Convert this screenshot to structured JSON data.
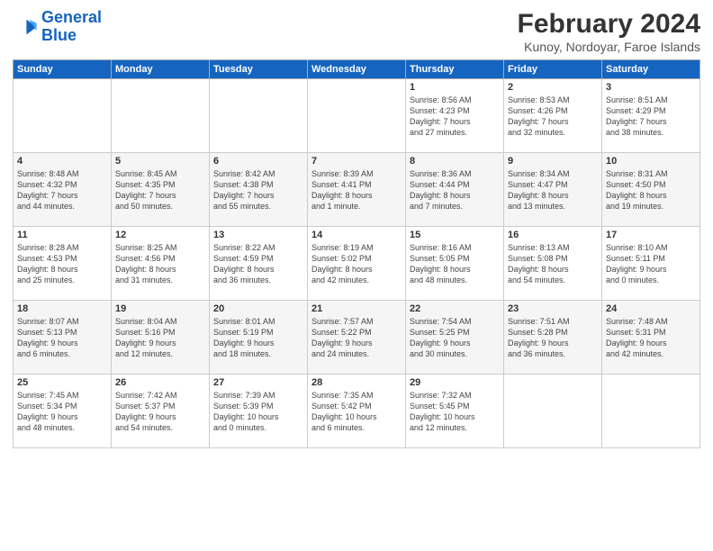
{
  "header": {
    "logo_line1": "General",
    "logo_line2": "Blue",
    "title": "February 2024",
    "subtitle": "Kunoy, Nordoyar, Faroe Islands"
  },
  "days_of_week": [
    "Sunday",
    "Monday",
    "Tuesday",
    "Wednesday",
    "Thursday",
    "Friday",
    "Saturday"
  ],
  "weeks": [
    [
      {
        "day": "",
        "content": ""
      },
      {
        "day": "",
        "content": ""
      },
      {
        "day": "",
        "content": ""
      },
      {
        "day": "",
        "content": ""
      },
      {
        "day": "1",
        "content": "Sunrise: 8:56 AM\nSunset: 4:23 PM\nDaylight: 7 hours\nand 27 minutes."
      },
      {
        "day": "2",
        "content": "Sunrise: 8:53 AM\nSunset: 4:26 PM\nDaylight: 7 hours\nand 32 minutes."
      },
      {
        "day": "3",
        "content": "Sunrise: 8:51 AM\nSunset: 4:29 PM\nDaylight: 7 hours\nand 38 minutes."
      }
    ],
    [
      {
        "day": "4",
        "content": "Sunrise: 8:48 AM\nSunset: 4:32 PM\nDaylight: 7 hours\nand 44 minutes."
      },
      {
        "day": "5",
        "content": "Sunrise: 8:45 AM\nSunset: 4:35 PM\nDaylight: 7 hours\nand 50 minutes."
      },
      {
        "day": "6",
        "content": "Sunrise: 8:42 AM\nSunset: 4:38 PM\nDaylight: 7 hours\nand 55 minutes."
      },
      {
        "day": "7",
        "content": "Sunrise: 8:39 AM\nSunset: 4:41 PM\nDaylight: 8 hours\nand 1 minute."
      },
      {
        "day": "8",
        "content": "Sunrise: 8:36 AM\nSunset: 4:44 PM\nDaylight: 8 hours\nand 7 minutes."
      },
      {
        "day": "9",
        "content": "Sunrise: 8:34 AM\nSunset: 4:47 PM\nDaylight: 8 hours\nand 13 minutes."
      },
      {
        "day": "10",
        "content": "Sunrise: 8:31 AM\nSunset: 4:50 PM\nDaylight: 8 hours\nand 19 minutes."
      }
    ],
    [
      {
        "day": "11",
        "content": "Sunrise: 8:28 AM\nSunset: 4:53 PM\nDaylight: 8 hours\nand 25 minutes."
      },
      {
        "day": "12",
        "content": "Sunrise: 8:25 AM\nSunset: 4:56 PM\nDaylight: 8 hours\nand 31 minutes."
      },
      {
        "day": "13",
        "content": "Sunrise: 8:22 AM\nSunset: 4:59 PM\nDaylight: 8 hours\nand 36 minutes."
      },
      {
        "day": "14",
        "content": "Sunrise: 8:19 AM\nSunset: 5:02 PM\nDaylight: 8 hours\nand 42 minutes."
      },
      {
        "day": "15",
        "content": "Sunrise: 8:16 AM\nSunset: 5:05 PM\nDaylight: 8 hours\nand 48 minutes."
      },
      {
        "day": "16",
        "content": "Sunrise: 8:13 AM\nSunset: 5:08 PM\nDaylight: 8 hours\nand 54 minutes."
      },
      {
        "day": "17",
        "content": "Sunrise: 8:10 AM\nSunset: 5:11 PM\nDaylight: 9 hours\nand 0 minutes."
      }
    ],
    [
      {
        "day": "18",
        "content": "Sunrise: 8:07 AM\nSunset: 5:13 PM\nDaylight: 9 hours\nand 6 minutes."
      },
      {
        "day": "19",
        "content": "Sunrise: 8:04 AM\nSunset: 5:16 PM\nDaylight: 9 hours\nand 12 minutes."
      },
      {
        "day": "20",
        "content": "Sunrise: 8:01 AM\nSunset: 5:19 PM\nDaylight: 9 hours\nand 18 minutes."
      },
      {
        "day": "21",
        "content": "Sunrise: 7:57 AM\nSunset: 5:22 PM\nDaylight: 9 hours\nand 24 minutes."
      },
      {
        "day": "22",
        "content": "Sunrise: 7:54 AM\nSunset: 5:25 PM\nDaylight: 9 hours\nand 30 minutes."
      },
      {
        "day": "23",
        "content": "Sunrise: 7:51 AM\nSunset: 5:28 PM\nDaylight: 9 hours\nand 36 minutes."
      },
      {
        "day": "24",
        "content": "Sunrise: 7:48 AM\nSunset: 5:31 PM\nDaylight: 9 hours\nand 42 minutes."
      }
    ],
    [
      {
        "day": "25",
        "content": "Sunrise: 7:45 AM\nSunset: 5:34 PM\nDaylight: 9 hours\nand 48 minutes."
      },
      {
        "day": "26",
        "content": "Sunrise: 7:42 AM\nSunset: 5:37 PM\nDaylight: 9 hours\nand 54 minutes."
      },
      {
        "day": "27",
        "content": "Sunrise: 7:39 AM\nSunset: 5:39 PM\nDaylight: 10 hours\nand 0 minutes."
      },
      {
        "day": "28",
        "content": "Sunrise: 7:35 AM\nSunset: 5:42 PM\nDaylight: 10 hours\nand 6 minutes."
      },
      {
        "day": "29",
        "content": "Sunrise: 7:32 AM\nSunset: 5:45 PM\nDaylight: 10 hours\nand 12 minutes."
      },
      {
        "day": "",
        "content": ""
      },
      {
        "day": "",
        "content": ""
      }
    ]
  ]
}
